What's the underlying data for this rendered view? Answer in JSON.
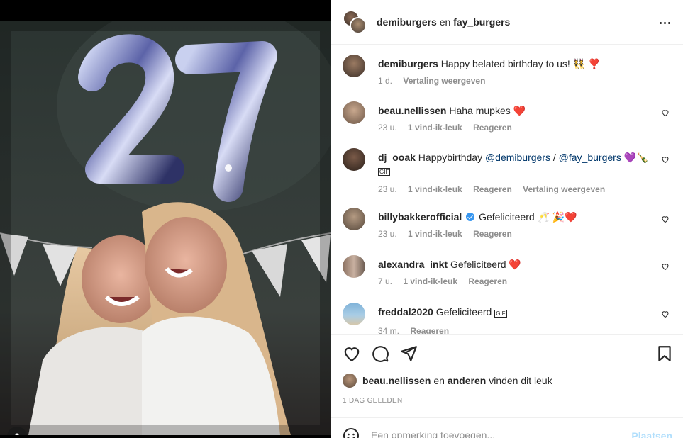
{
  "post": {
    "header": {
      "user1": "demiburgers",
      "conjunction": "en",
      "user2": "fay_burgers"
    },
    "caption": {
      "username": "demiburgers",
      "text": "Happy belated birthday to us! 👯 ❣️",
      "time": "1 d.",
      "translate": "Vertaling weergeven"
    },
    "comments": [
      {
        "username": "beau.nellissen",
        "text": "Haha mupkes ❤️",
        "time": "23 u.",
        "likes": "1 vind-ik-leuk",
        "reply": "Reageren",
        "translate": ""
      },
      {
        "username": "dj_ooak",
        "text_before": "Happybirthday ",
        "mention1": "@demiburgers",
        "sep": " / ",
        "mention2": "@fay_burgers",
        "text_after": " 💜🍾",
        "gif": "GIF",
        "time": "23 u.",
        "likes": "1 vind-ik-leuk",
        "reply": "Reageren",
        "translate": "Vertaling weergeven"
      },
      {
        "username": "billybakkerofficial",
        "text": "Gefeliciteerd 🥂 🎉❤️",
        "time": "23 u.",
        "likes": "1 vind-ik-leuk",
        "reply": "Reageren",
        "translate": ""
      },
      {
        "username": "alexandra_inkt",
        "text": "Gefeliciteerd ❤️",
        "time": "7 u.",
        "likes": "1 vind-ik-leuk",
        "reply": "Reageren",
        "translate": ""
      },
      {
        "username": "freddal2020",
        "text": "Gefeliciteerd",
        "gif": "GIF",
        "time": "34 m.",
        "likes": "",
        "reply": "Reageren",
        "translate": ""
      }
    ],
    "likes": {
      "user": "beau.nellissen",
      "conjunction": "en",
      "others": "anderen",
      "suffix": "vinden dit leuk"
    },
    "date": "1 DAG GELEDEN",
    "add_comment": {
      "placeholder": "Een opmerking toevoegen...",
      "post_label": "Plaatsen"
    },
    "photo": {
      "balloon_text": "27"
    }
  },
  "colors": {
    "mention": "#00376b",
    "muted": "#8e8e8e",
    "post_button_disabled": "#b2dffc",
    "verified": "#3897f0",
    "heart_red": "#ed4956"
  },
  "icons": [
    "heart-icon",
    "comment-icon",
    "share-icon",
    "bookmark-icon",
    "more-icon",
    "emoji-icon",
    "user-tag-icon",
    "verified-icon"
  ]
}
